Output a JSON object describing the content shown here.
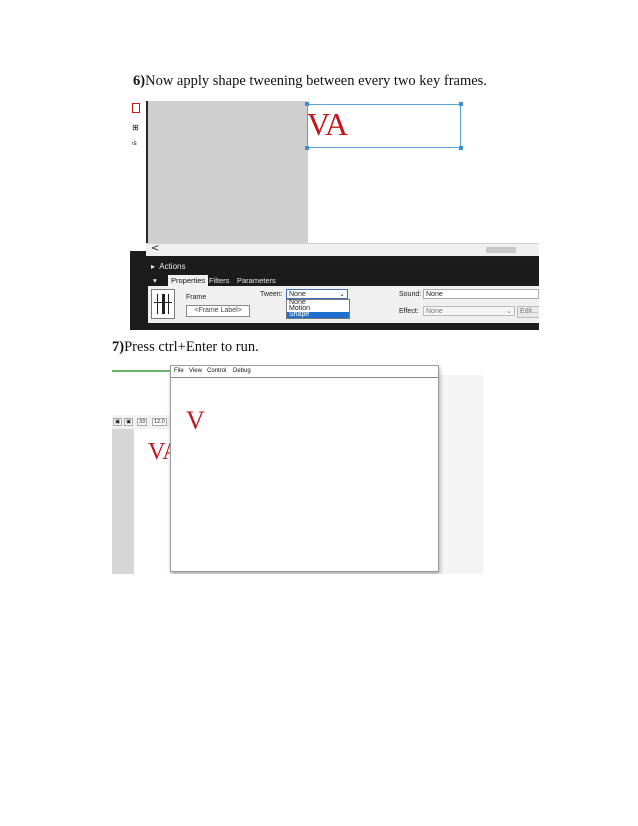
{
  "step6": {
    "number": "6)",
    "text": "Now apply shape tweening between every two key frames."
  },
  "step7": {
    "number": "7)",
    "text": "Press ctrl+Enter to run."
  },
  "screenshot1": {
    "left_icons": [
      "ls1",
      "ls2",
      "ls3"
    ],
    "stage_text": "VA",
    "scroll_arrow": "<",
    "actions_panel": "Actions",
    "tabs": [
      "Properties",
      "Filters",
      "Parameters"
    ],
    "frame_label": "Frame",
    "frame_label_input_placeholder": "<Frame Label>",
    "tween_label": "Tween:",
    "tween_value": "None",
    "tween_options": [
      "None",
      "Motion",
      "Shape"
    ],
    "tween_selected_option": "Shape",
    "sound_label": "Sound:",
    "sound_value": "None",
    "effect_label": "Effect:",
    "effect_value": "None",
    "edit_button": "Edit..."
  },
  "screenshot2": {
    "menu": [
      "File",
      "View",
      "Control",
      "Debug"
    ],
    "zoom_values": [
      "33",
      "12.0"
    ],
    "stage_text_partial": "VA",
    "player_text": "V"
  },
  "colors": {
    "letter_red": "#c0181c",
    "selection_blue": "#1e6fd0",
    "bounding_box": "#58a2d8"
  }
}
